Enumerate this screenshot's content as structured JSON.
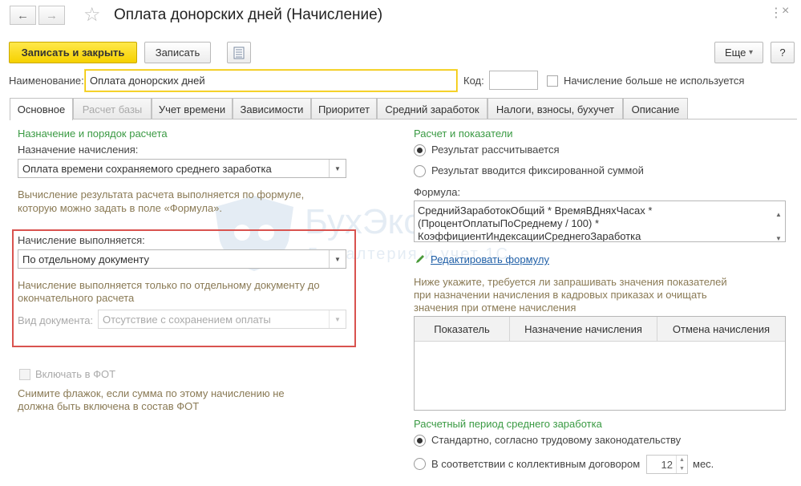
{
  "window": {
    "title": "Оплата донорских дней (Начисление)",
    "nav_back": "←",
    "nav_forward": "→",
    "favorite": "☆"
  },
  "toolbar": {
    "save_close": "Записать и закрыть",
    "save": "Записать",
    "more": "Еще",
    "more_arrow": "▾",
    "help": "?"
  },
  "header": {
    "name_label": "Наименование:",
    "name_value": "Оплата донорских дней",
    "code_label": "Код:",
    "code_value": "",
    "not_used_label": "Начисление больше не используется"
  },
  "tabs": [
    {
      "label": "Основное"
    },
    {
      "label": "Расчет базы"
    },
    {
      "label": "Учет времени"
    },
    {
      "label": "Зависимости"
    },
    {
      "label": "Приоритет"
    },
    {
      "label": "Средний заработок"
    },
    {
      "label": "Налоги, взносы, бухучет"
    },
    {
      "label": "Описание"
    }
  ],
  "left": {
    "section_title": "Назначение и порядок расчета",
    "purpose_label": "Назначение начисления:",
    "purpose_value": "Оплата времени сохраняемого среднего заработка",
    "formula_hint_1": "Вычисление результата расчета выполняется по формуле,",
    "formula_hint_2": "которую можно задать в поле «Формула».",
    "performed_label": "Начисление выполняется:",
    "performed_value": "По отдельному документу",
    "performed_hint_1": "Начисление выполняется только по отдельному документу до",
    "performed_hint_2": "окончательного расчета",
    "doc_type_label": "Вид документа:",
    "doc_type_value": "Отсутствие с сохранением оплаты",
    "fot_label": "Включать в ФОТ",
    "fot_hint_1": "Снимите флажок, если сумма по этому начислению не",
    "fot_hint_2": "должна быть включена в состав ФОТ"
  },
  "right": {
    "section_title": "Расчет и показатели",
    "radio_calculated": "Результат рассчитывается",
    "radio_fixed": "Результат вводится фиксированной суммой",
    "formula_label": "Формула:",
    "formula_lines": [
      "СреднийЗаработокОбщий * ВремяВДняхЧасах *",
      "(ПроцентОплатыПоСреднему / 100) *",
      "КоэффициентИндексацииСреднегоЗаработка"
    ],
    "edit_formula": "Редактировать формулу",
    "indicators_hint_1": "Ниже укажите, требуется ли запрашивать значения показателей",
    "indicators_hint_2": "при назначении начисления в кадровых приказах и очищать",
    "indicators_hint_3": "значения при отмене начисления",
    "grid_columns": [
      "Показатель",
      "Назначение начисления",
      "Отмена начисления"
    ],
    "period_title": "Расчетный период среднего заработка",
    "radio_standard": "Стандартно, согласно трудовому законодательству",
    "radio_collective": "В соответствии с коллективным договором",
    "months_value": "12",
    "months_unit": "мес."
  },
  "watermark": {
    "text": "БухЭксперт",
    "subtext": "Бухгалтерия и учет 1С"
  },
  "colors": {
    "primary_button": "#f6d100",
    "section_green": "#3a9a43",
    "hint_brown": "#8a7a55",
    "highlight_red": "#d9534f",
    "link_blue": "#1f5fa7"
  }
}
